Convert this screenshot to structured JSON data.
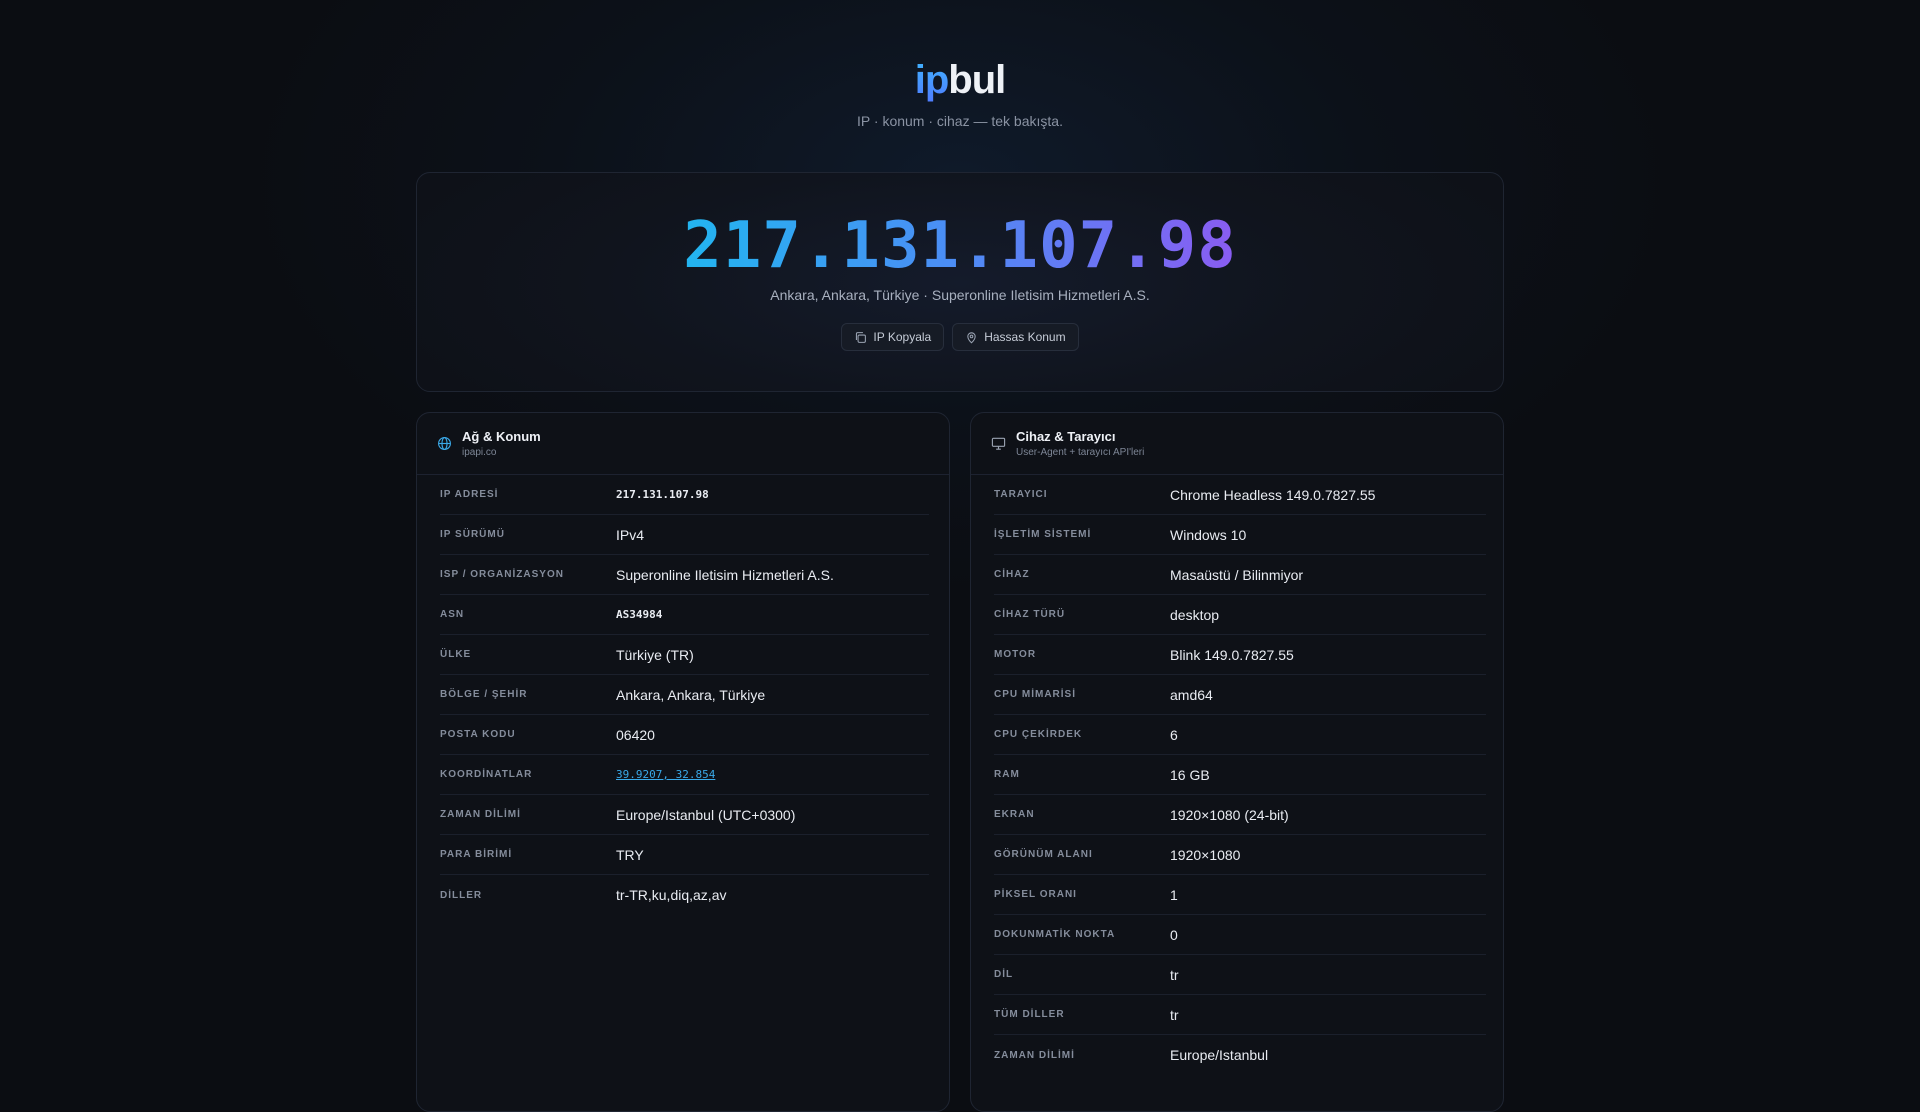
{
  "brand": {
    "ip": "ip",
    "bul": "bul",
    "tagline": "IP · konum · cihaz — tek bakışta."
  },
  "hero": {
    "ip": "217.131.107.98",
    "location": "Ankara, Ankara, Türkiye · Superonline Iletisim Hizmetleri A.S.",
    "copy_label": "IP Kopyala",
    "precise_label": "Hassas Konum"
  },
  "network": {
    "title": "Ağ & Konum",
    "subtitle": "ipapi.co",
    "icon": "globe-icon",
    "rows": [
      {
        "key": "IP ADRESİ",
        "value": "217.131.107.98",
        "style": "mono"
      },
      {
        "key": "IP SÜRÜMÜ",
        "value": "IPv4"
      },
      {
        "key": "ISP / ORGANİZASYON",
        "value": "Superonline Iletisim Hizmetleri A.S."
      },
      {
        "key": "ASN",
        "value": "AS34984",
        "style": "mono"
      },
      {
        "key": "ÜLKE",
        "value": "Türkiye (TR)"
      },
      {
        "key": "BÖLGE / ŞEHİR",
        "value": "Ankara, Ankara, Türkiye"
      },
      {
        "key": "POSTA KODU",
        "value": "06420"
      },
      {
        "key": "KOORDİNATLAR",
        "value": "39.9207, 32.854",
        "style": "link"
      },
      {
        "key": "ZAMAN DİLİMİ",
        "value": "Europe/Istanbul (UTC+0300)"
      },
      {
        "key": "PARA BİRİMİ",
        "value": "TRY"
      },
      {
        "key": "DİLLER",
        "value": "tr-TR,ku,diq,az,av"
      }
    ]
  },
  "device": {
    "title": "Cihaz & Tarayıcı",
    "subtitle": "User-Agent + tarayıcı API'leri",
    "icon": "monitor-icon",
    "rows": [
      {
        "key": "TARAYICI",
        "value": "Chrome Headless 149.0.7827.55"
      },
      {
        "key": "İŞLETİM SİSTEMİ",
        "value": "Windows 10"
      },
      {
        "key": "CİHAZ",
        "value": "Masaüstü / Bilinmiyor"
      },
      {
        "key": "CİHAZ TÜRÜ",
        "value": "desktop"
      },
      {
        "key": "MOTOR",
        "value": "Blink 149.0.7827.55"
      },
      {
        "key": "CPU MİMARİSİ",
        "value": "amd64"
      },
      {
        "key": "CPU ÇEKİRDEK",
        "value": "6"
      },
      {
        "key": "RAM",
        "value": "16 GB"
      },
      {
        "key": "EKRAN",
        "value": "1920×1080 (24-bit)"
      },
      {
        "key": "GÖRÜNÜM ALANI",
        "value": "1920×1080"
      },
      {
        "key": "PİKSEL ORANI",
        "value": "1"
      },
      {
        "key": "DOKUNMATİK NOKTA",
        "value": "0"
      },
      {
        "key": "DİL",
        "value": "tr"
      },
      {
        "key": "TÜM DİLLER",
        "value": "tr"
      },
      {
        "key": "ZAMAN DİLİMİ",
        "value": "Europe/Istanbul"
      }
    ]
  }
}
